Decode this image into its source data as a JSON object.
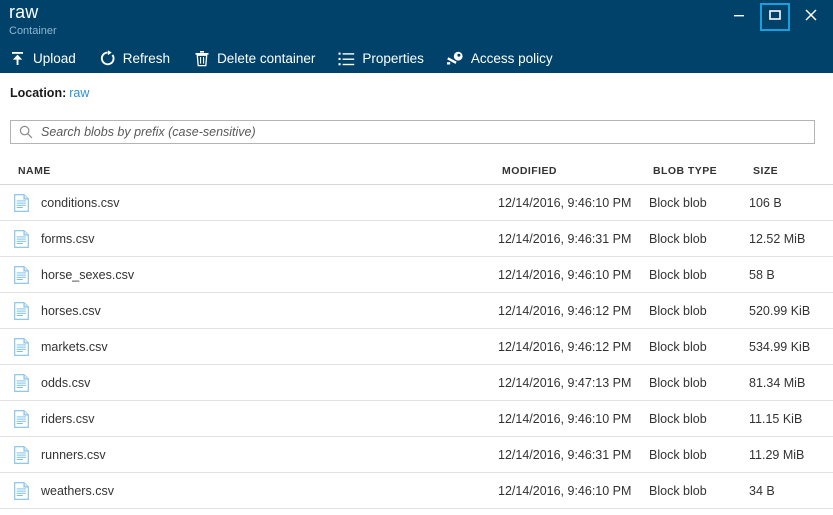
{
  "window": {
    "title": "raw",
    "subtitle": "Container",
    "controls": [
      {
        "name": "minimize",
        "icon": "minimize-icon",
        "label": "Minimize"
      },
      {
        "name": "restore",
        "icon": "restore-icon",
        "label": "Restore"
      },
      {
        "name": "close",
        "icon": "close-icon",
        "label": "Close"
      }
    ]
  },
  "toolbar": {
    "items": [
      {
        "label": "Upload",
        "icon": "upload-icon"
      },
      {
        "label": "Refresh",
        "icon": "refresh-icon"
      },
      {
        "label": "Delete container",
        "icon": "trash-icon"
      },
      {
        "label": "Properties",
        "icon": "list-icon"
      },
      {
        "label": "Access policy",
        "icon": "key-icon"
      }
    ]
  },
  "location": {
    "label": "Location:",
    "value": "raw"
  },
  "search": {
    "placeholder": "Search blobs by prefix (case-sensitive)",
    "value": "",
    "icon": "search-icon"
  },
  "table": {
    "columns": [
      "NAME",
      "MODIFIED",
      "BLOB TYPE",
      "SIZE"
    ],
    "rows": [
      {
        "name": "conditions.csv",
        "modified": "12/14/2016, 9:46:10 PM",
        "type": "Block blob",
        "size": "106 B",
        "icon": "file-csv-icon"
      },
      {
        "name": "forms.csv",
        "modified": "12/14/2016, 9:46:31 PM",
        "type": "Block blob",
        "size": "12.52 MiB",
        "icon": "file-csv-icon"
      },
      {
        "name": "horse_sexes.csv",
        "modified": "12/14/2016, 9:46:10 PM",
        "type": "Block blob",
        "size": "58 B",
        "icon": "file-csv-icon"
      },
      {
        "name": "horses.csv",
        "modified": "12/14/2016, 9:46:12 PM",
        "type": "Block blob",
        "size": "520.99 KiB",
        "icon": "file-csv-icon"
      },
      {
        "name": "markets.csv",
        "modified": "12/14/2016, 9:46:12 PM",
        "type": "Block blob",
        "size": "534.99 KiB",
        "icon": "file-csv-icon"
      },
      {
        "name": "odds.csv",
        "modified": "12/14/2016, 9:47:13 PM",
        "type": "Block blob",
        "size": "81.34 MiB",
        "icon": "file-csv-icon"
      },
      {
        "name": "riders.csv",
        "modified": "12/14/2016, 9:46:10 PM",
        "type": "Block blob",
        "size": "11.15 KiB",
        "icon": "file-csv-icon"
      },
      {
        "name": "runners.csv",
        "modified": "12/14/2016, 9:46:31 PM",
        "type": "Block blob",
        "size": "11.29 MiB",
        "icon": "file-csv-icon"
      },
      {
        "name": "weathers.csv",
        "modified": "12/14/2016, 9:46:10 PM",
        "type": "Block blob",
        "size": "34 B",
        "icon": "file-csv-icon"
      }
    ]
  },
  "colors": {
    "header_bg": "#01426a",
    "accent_link": "#2e8fd4",
    "restore_highlight": "#16a0e0",
    "subtitle": "#90b5cf",
    "icon_blue": "#7fc0e8",
    "row_divider": "#e2e2e2"
  }
}
